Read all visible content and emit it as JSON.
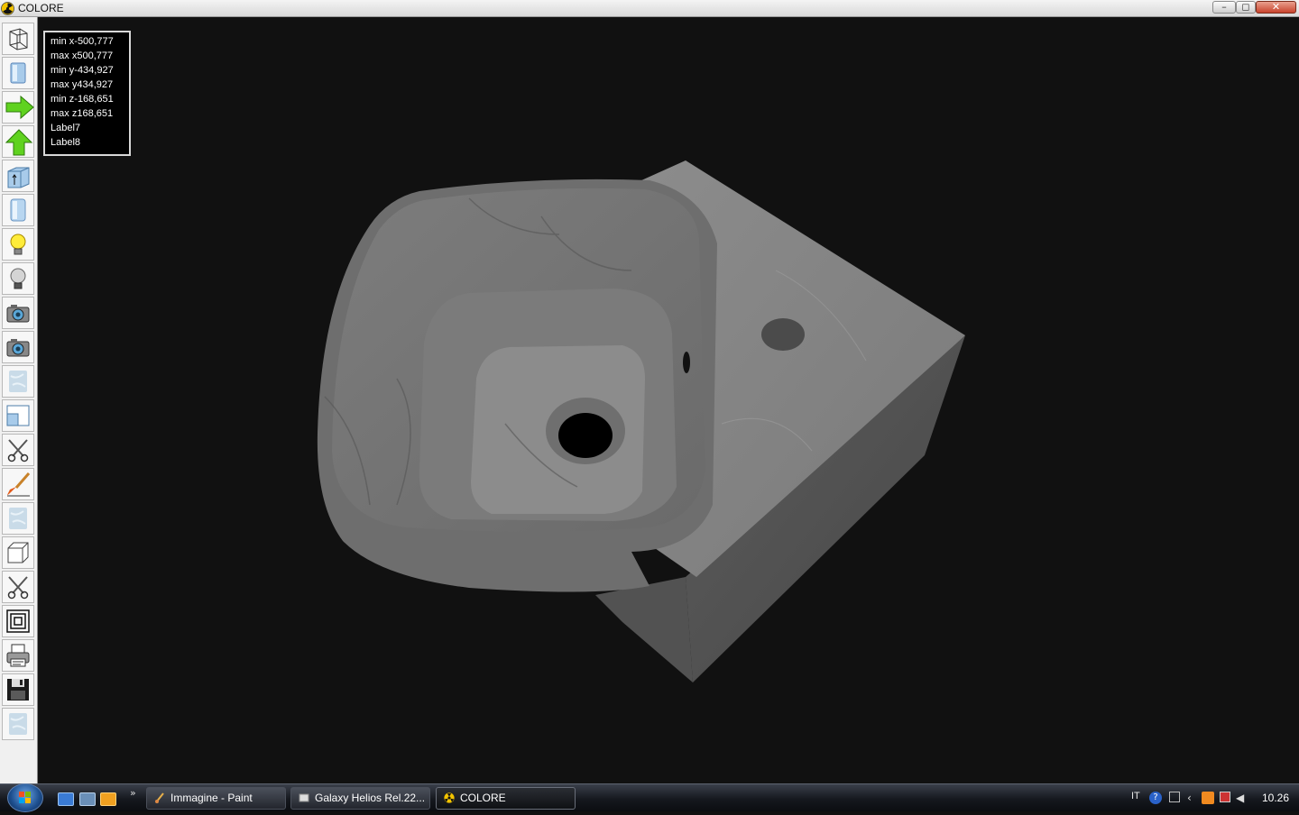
{
  "window": {
    "title": "COLORE",
    "controls": {
      "minimize": "–",
      "maximize": "◻",
      "close": "✕"
    }
  },
  "toolbar": {
    "tools": [
      {
        "name": "wireframe-tool",
        "icon": "wireframe-icon"
      },
      {
        "name": "solid-view-tool",
        "icon": "blue-panel-icon"
      },
      {
        "name": "arrow-right-tool",
        "icon": "green-arrow-right-icon"
      },
      {
        "name": "arrow-up-tool",
        "icon": "green-arrow-up-icon"
      },
      {
        "name": "box-up-tool",
        "icon": "box-up-icon"
      },
      {
        "name": "panel-tool",
        "icon": "blue-panel-icon"
      },
      {
        "name": "light-on-tool",
        "icon": "lightbulb-on-icon"
      },
      {
        "name": "light-off-tool",
        "icon": "lightbulb-off-icon"
      },
      {
        "name": "camera-tool",
        "icon": "camera-icon"
      },
      {
        "name": "camera-tool-2",
        "icon": "camera-icon"
      },
      {
        "name": "texture-tool",
        "icon": "marble-texture-icon"
      },
      {
        "name": "window-tool",
        "icon": "window-icon"
      },
      {
        "name": "cut-tool",
        "icon": "scissors-icon"
      },
      {
        "name": "paint-tool",
        "icon": "brush-icon"
      },
      {
        "name": "texture-tool-2",
        "icon": "marble-texture-icon"
      },
      {
        "name": "cube-tool",
        "icon": "cube-icon"
      },
      {
        "name": "cut-tool-2",
        "icon": "scissors-icon"
      },
      {
        "name": "frame-tool",
        "icon": "nested-squares-icon"
      },
      {
        "name": "print-tool",
        "icon": "printer-icon"
      },
      {
        "name": "save-tool",
        "icon": "floppy-icon"
      },
      {
        "name": "texture-tool-3",
        "icon": "marble-texture-icon"
      }
    ]
  },
  "info_panel": {
    "lines": [
      "min x-500,777",
      "max x500,777",
      "min y-434,927",
      "max y434,927",
      "min z-168,651",
      "max z168,651",
      "Label7",
      "Label8"
    ]
  },
  "taskbar": {
    "quick_launch_more": "»",
    "tasks": [
      {
        "label": "Immagine - Paint",
        "active": false
      },
      {
        "label": "Galaxy Helios  Rel.22...",
        "active": false
      },
      {
        "label": "COLORE",
        "active": true
      }
    ],
    "tray": {
      "language": "IT",
      "clock": "10.26"
    }
  },
  "colors": {
    "viewport_bg": "#111111",
    "marble_light": "#8a8a8a",
    "marble_mid": "#6d6d6d",
    "marble_dark": "#4f4f4f"
  }
}
